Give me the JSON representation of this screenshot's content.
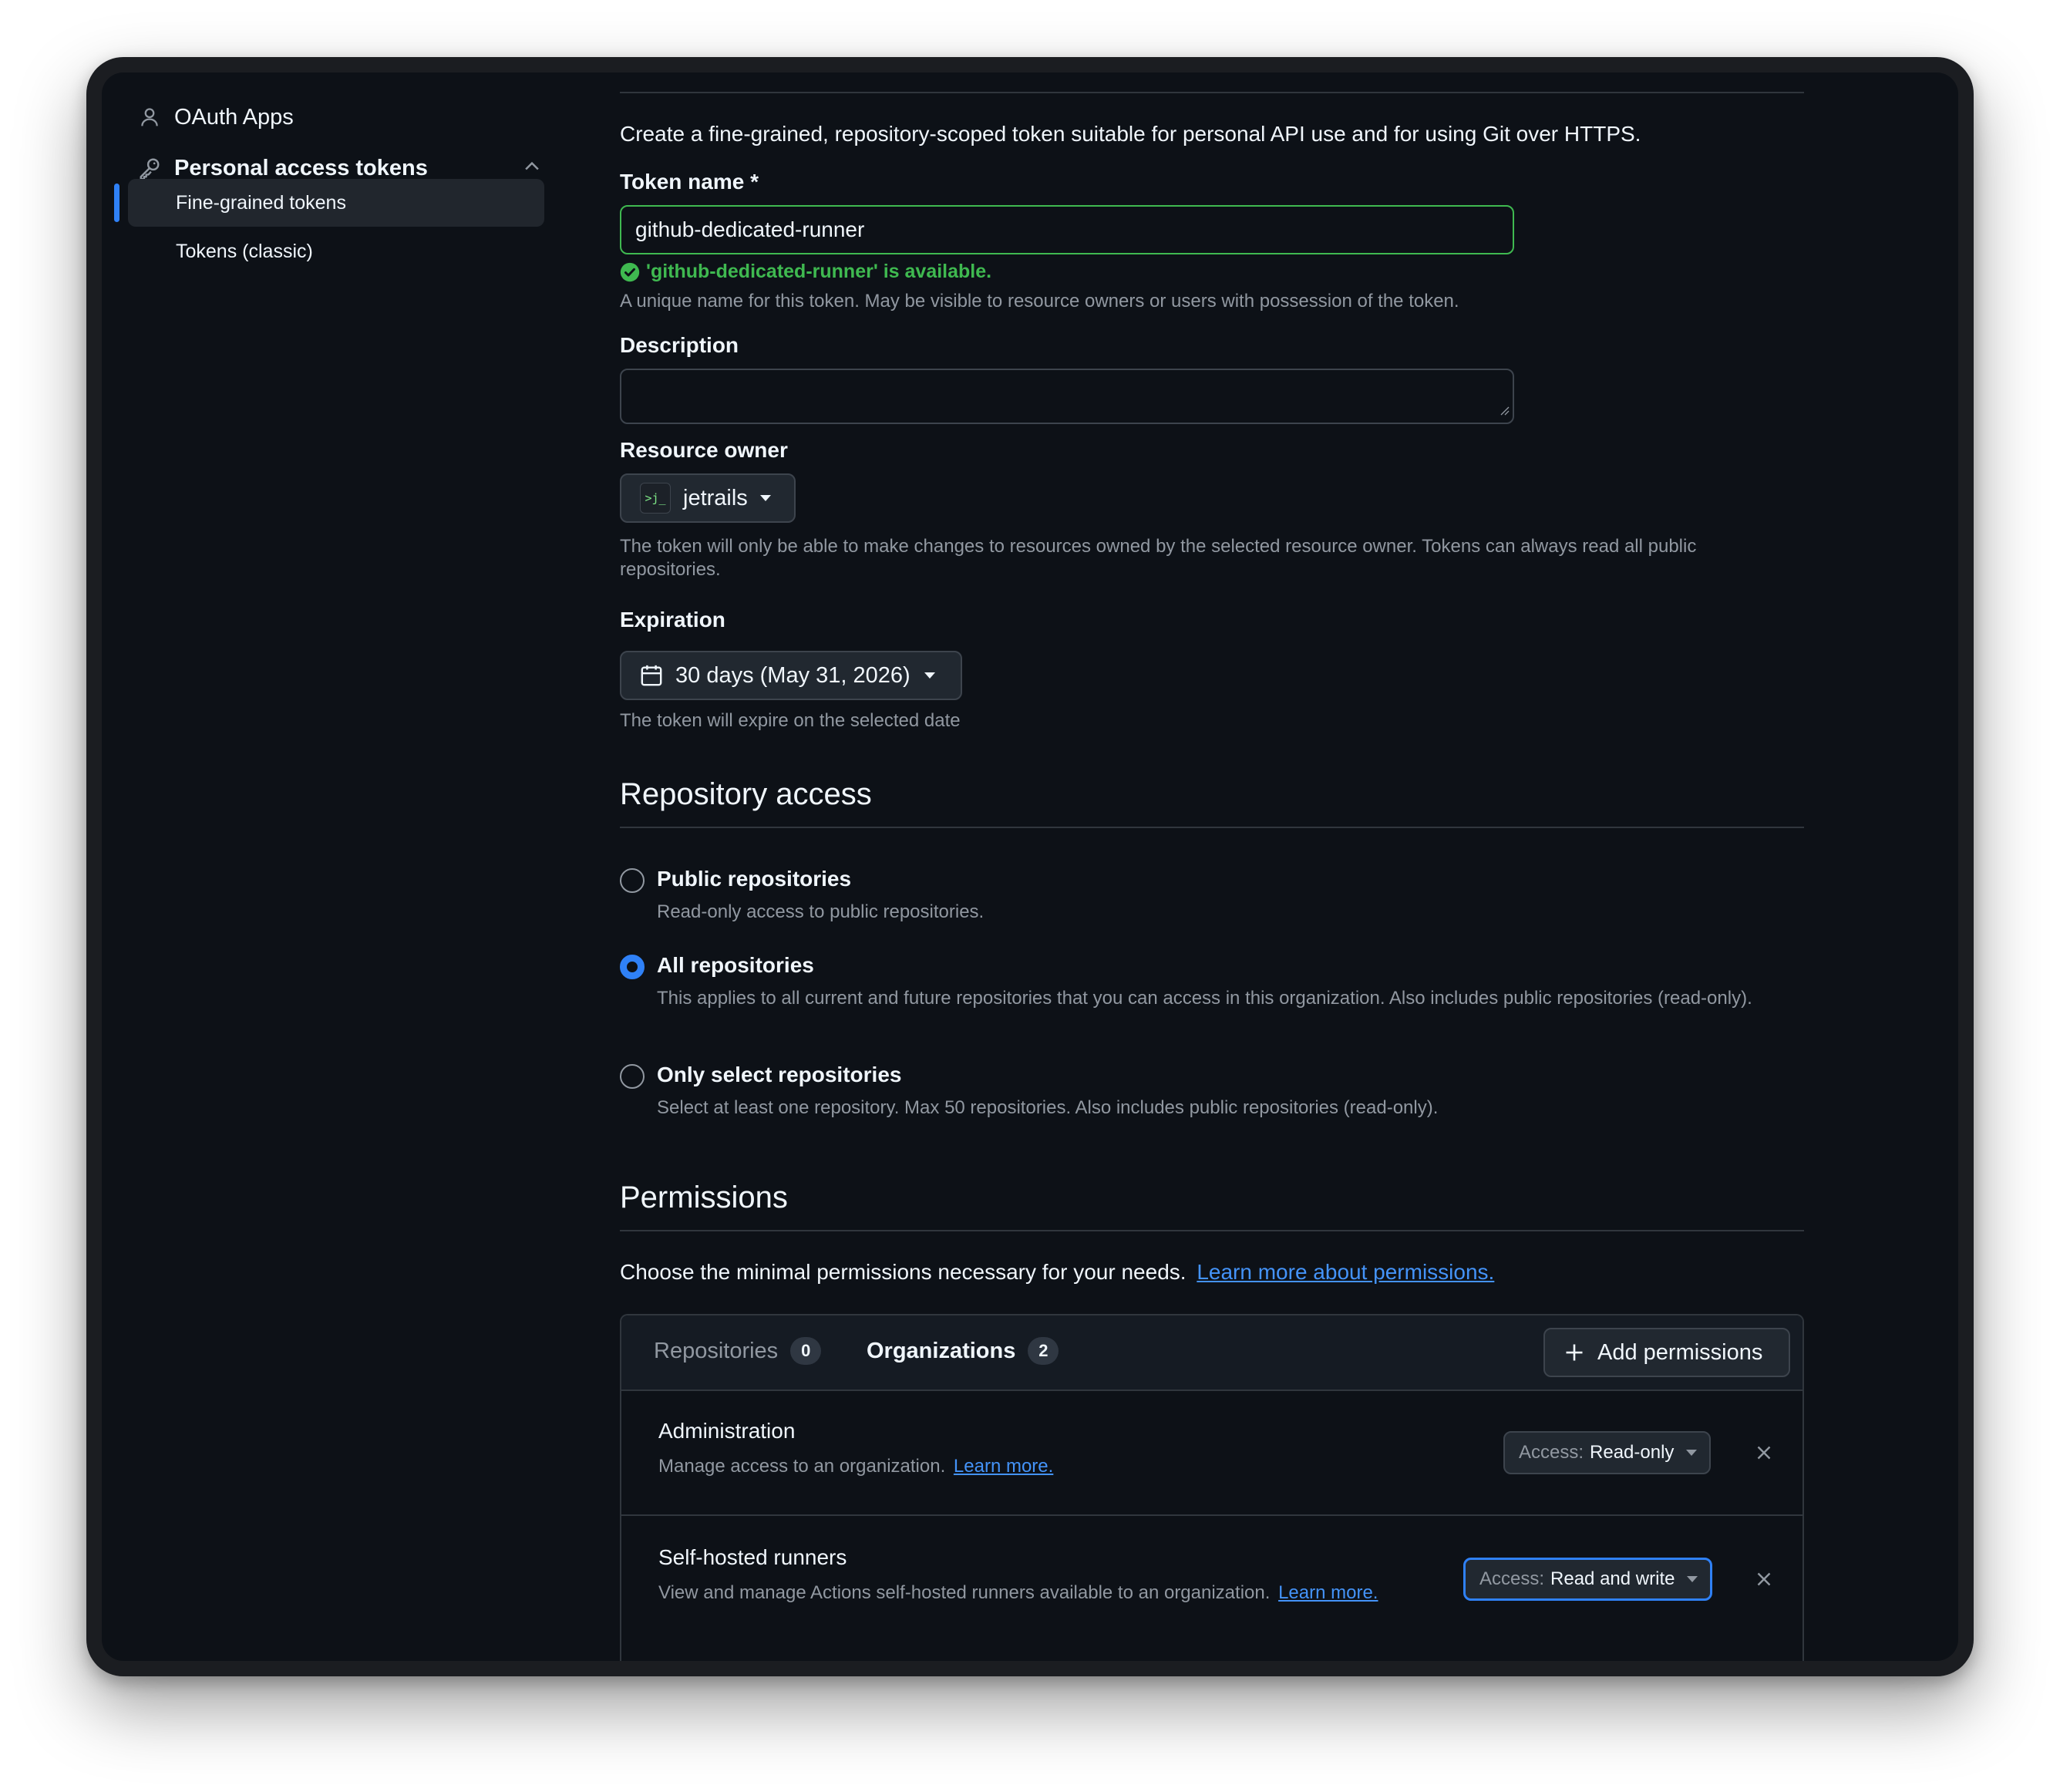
{
  "sidebar": {
    "oauth_apps": "OAuth Apps",
    "personal_access_tokens": "Personal access tokens",
    "fine_grained_tokens": "Fine-grained tokens",
    "tokens_classic": "Tokens (classic)"
  },
  "form": {
    "intro": "Create a fine-grained, repository-scoped token suitable for personal API use and for using Git over HTTPS.",
    "token_name_label": "Token name *",
    "token_name_value": "github-dedicated-runner",
    "token_name_available": "'github-dedicated-runner' is available.",
    "token_name_hint": "A unique name for this token. May be visible to resource owners or users with possession of the token.",
    "description_label": "Description",
    "description_value": "",
    "resource_owner_label": "Resource owner",
    "resource_owner_avatar_text": ">j_",
    "resource_owner_value": "jetrails",
    "resource_owner_hint": "The token will only be able to make changes to resources owned by the selected resource owner. Tokens can always read all public repositories.",
    "expiration_label": "Expiration",
    "expiration_value": "30 days (May 31, 2026)",
    "expiration_hint": "The token will expire on the selected date"
  },
  "repo_access": {
    "heading": "Repository access",
    "options": [
      {
        "title": "Public repositories",
        "desc": "Read-only access to public repositories.",
        "checked": false
      },
      {
        "title": "All repositories",
        "desc": "This applies to all current and future repositories that you can access in this organization. Also includes public repositories (read-only).",
        "checked": true
      },
      {
        "title": "Only select repositories",
        "desc": "Select at least one repository. Max 50 repositories. Also includes public repositories (read-only).",
        "checked": false
      }
    ]
  },
  "permissions": {
    "heading": "Permissions",
    "intro": "Choose the minimal permissions necessary for your needs.",
    "learn_more_link": "Learn more about permissions.",
    "tabs": [
      {
        "label": "Repositories",
        "count": "0",
        "selected": false
      },
      {
        "label": "Organizations",
        "count": "2",
        "selected": true
      }
    ],
    "add_button": "Add permissions",
    "rows": [
      {
        "title": "Administration",
        "desc": "Manage access to an organization.",
        "link": "Learn more.",
        "access_key": "Access:",
        "access_value": "Read-only"
      },
      {
        "title": "Self-hosted runners",
        "desc": "View and manage Actions self-hosted runners available to an organization.",
        "link": "Learn more.",
        "access_key": "Access:",
        "access_value": "Read and write"
      }
    ]
  },
  "colors": {
    "background": "#0d1117",
    "accent": "#2f81f7",
    "success": "#3fb950",
    "link": "#4493f8",
    "muted_text": "#9198a1"
  }
}
